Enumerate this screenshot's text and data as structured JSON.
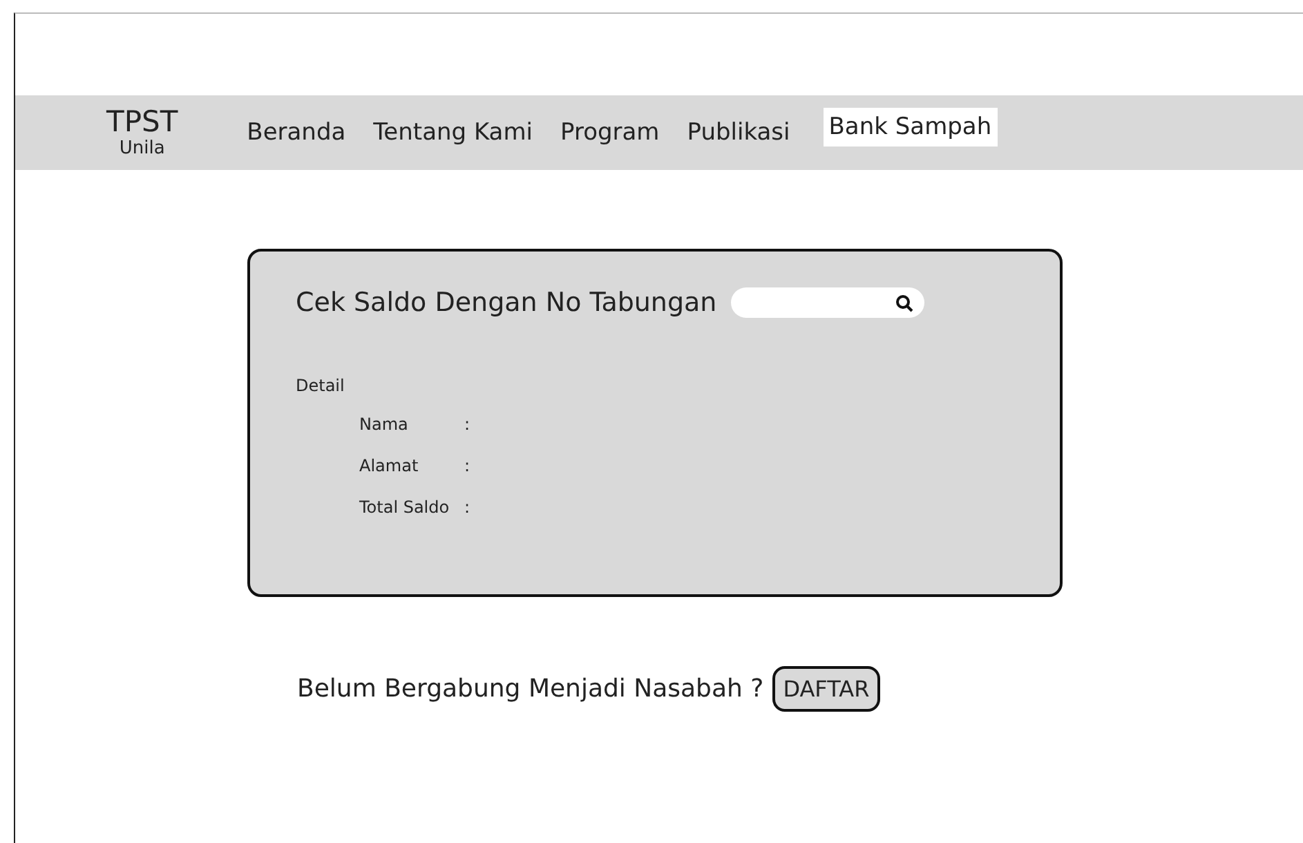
{
  "logo": {
    "title": "TPST",
    "subtitle": "Unila"
  },
  "nav": [
    {
      "label": "Beranda",
      "selected": false
    },
    {
      "label": "Tentang Kami",
      "selected": false
    },
    {
      "label": "Program",
      "selected": false
    },
    {
      "label": "Publikasi",
      "selected": false
    },
    {
      "label": "Bank Sampah",
      "selected": true
    }
  ],
  "card": {
    "title": "Cek Saldo Dengan No Tabungan",
    "section": "Detail",
    "fields": [
      {
        "label": "Nama",
        "sep": ":"
      },
      {
        "label": "Alamat",
        "sep": ":"
      },
      {
        "label": "Total Saldo",
        "sep": ":"
      }
    ]
  },
  "signup": {
    "text": "Belum Bergabung Menjadi Nasabah ?",
    "button": "DAFTAR"
  }
}
